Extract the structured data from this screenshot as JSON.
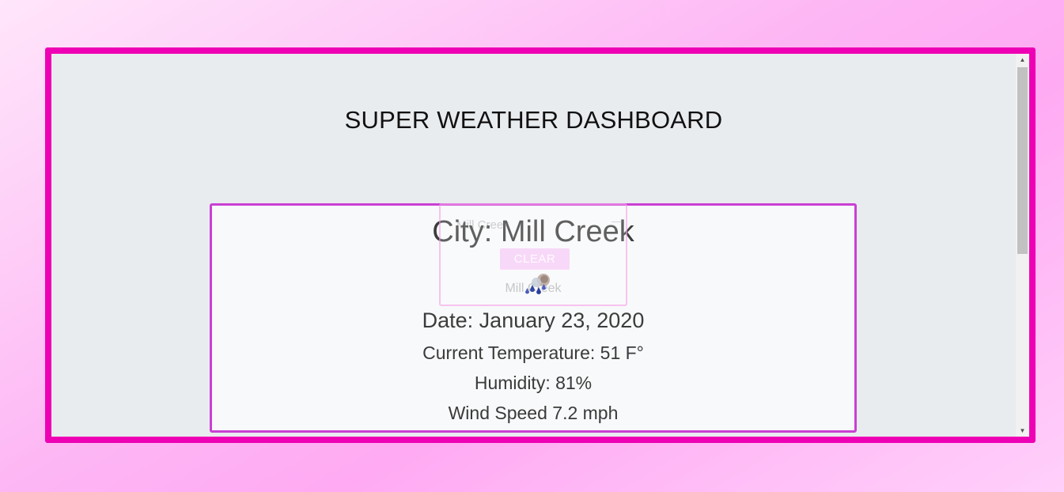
{
  "header": {
    "title": "SUPER WEATHER DASHBOARD"
  },
  "search": {
    "value": "Mill Creek",
    "clear_label": "CLEAR",
    "history": [
      "Mill Creek"
    ]
  },
  "weather": {
    "city": "City: Mill Creek",
    "date": "Date: January 23, 2020",
    "temperature": "Current Temperature: 51 F°",
    "humidity": "Humidity: 81%",
    "wind": "Wind Speed 7.2 mph",
    "icon": "rain-cloud-icon"
  },
  "colors": {
    "frame_border": "#ee00b4",
    "card_border": "#c940d3",
    "panel_background": "#e9ecef",
    "card_background": "#f8f9fa"
  }
}
